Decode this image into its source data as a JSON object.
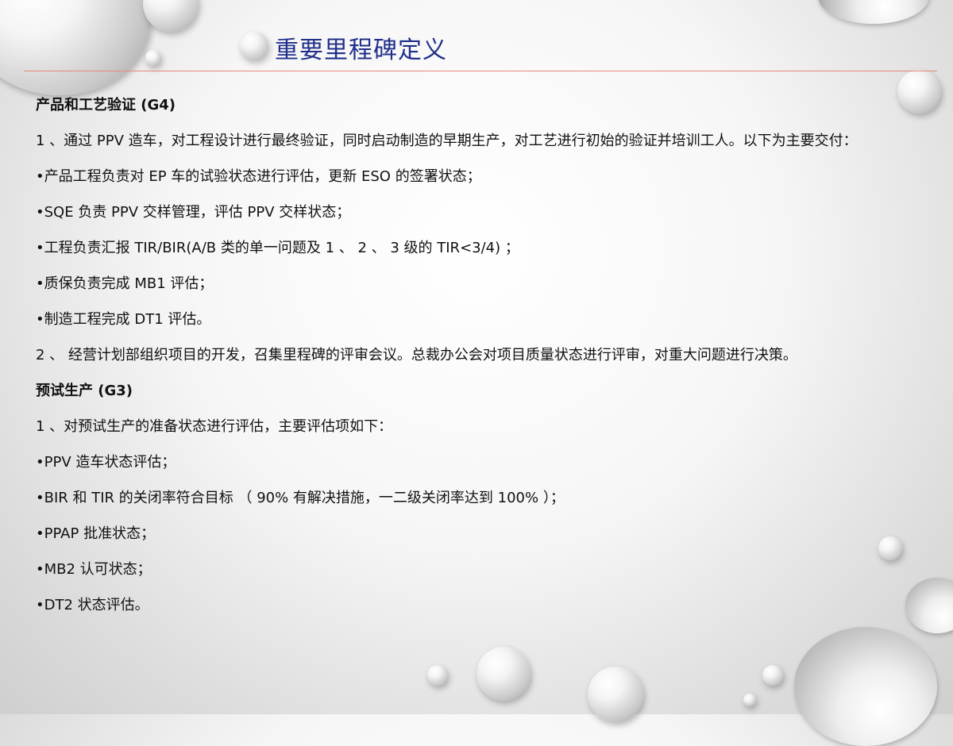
{
  "slide": {
    "title": "重要里程碑定义",
    "lines": [
      {
        "text": "产品和工艺验证 (G4)",
        "heading": true
      },
      {
        "text": "1 、通过 PPV 造车，对工程设计进行最终验证，同时启动制造的早期生产，对工艺进行初始的验证并培训工人。以下为主要交付：",
        "heading": false
      },
      {
        "text": "•产品工程负责对 EP 车的试验状态进行评估，更新 ESO 的签署状态；",
        "heading": false
      },
      {
        "text": "•SQE 负责 PPV 交样管理，评估 PPV 交样状态；",
        "heading": false
      },
      {
        "text": "•工程负责汇报 TIR/BIR(A/B 类的单一问题及 1 、 2 、 3 级的 TIR<3/4) ；",
        "heading": false
      },
      {
        "text": "•质保负责完成 MB1 评估；",
        "heading": false
      },
      {
        "text": "•制造工程完成 DT1 评估。",
        "heading": false
      },
      {
        "text": "2 、 经营计划部组织项目的开发，召集里程碑的评审会议。总裁办公会对项目质量状态进行评审，对重大问题进行决策。",
        "heading": false
      },
      {
        "text": "预试生产 (G3)",
        "heading": true
      },
      {
        "text": "1 、对预试生产的准备状态进行评估，主要评估项如下：",
        "heading": false
      },
      {
        "text": "•PPV 造车状态评估；",
        "heading": false
      },
      {
        "text": "•BIR 和 TIR 的关闭率符合目标 （ 90% 有解决措施，一二级关闭率达到 100% ）；",
        "heading": false
      },
      {
        "text": "•PPAP 批准状态；",
        "heading": false
      },
      {
        "text": "•MB2 认可状态；",
        "heading": false
      },
      {
        "text": "•DT2 状态评估。",
        "heading": false
      }
    ]
  },
  "colors": {
    "title": "#1f2f8a",
    "divider": "#e58a72",
    "text": "#111111"
  }
}
